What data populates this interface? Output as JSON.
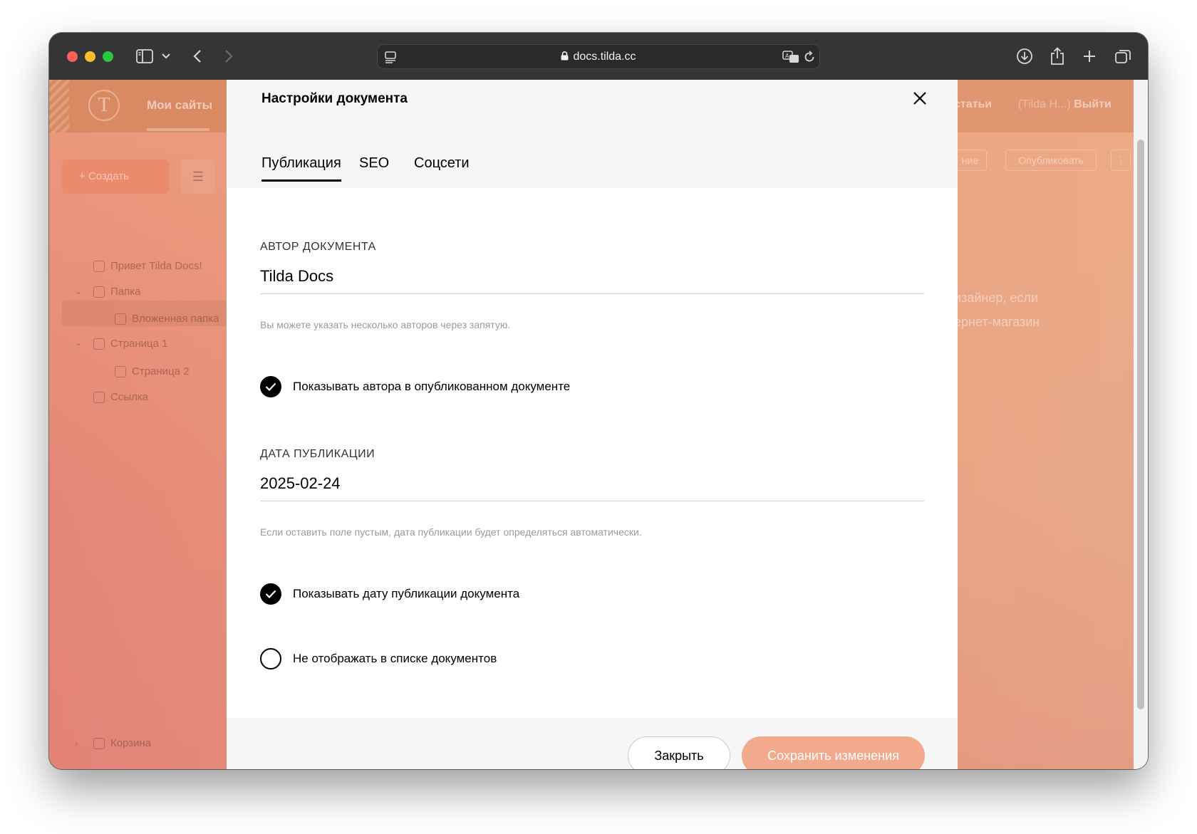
{
  "browser": {
    "url": "docs.tilda.cc"
  },
  "background": {
    "my_sites": "Мои сайты",
    "create": "+ Создать",
    "nav": [
      "Привет Tilda Docs!",
      "Папка",
      "Вложенная папка",
      "Страница 1",
      "Страница 2",
      "Ссылка"
    ],
    "trash": "Корзина",
    "top_articles": "статьи",
    "top_user": "(Tilda H...)",
    "top_logout": "Выйти",
    "pill_left": "ние",
    "pill_publish": "Опубликовать",
    "text_line_1": "изайнер, если",
    "text_line_2": "ернет-магазин"
  },
  "modal": {
    "title": "Настройки документа",
    "tabs": [
      {
        "label": "Публикация",
        "active": true
      },
      {
        "label": "SEO",
        "active": false
      },
      {
        "label": "Соцсети",
        "active": false
      }
    ],
    "author": {
      "label": "АВТОР ДОКУМЕНТА",
      "value": "Tilda Docs",
      "hint": "Вы можете указать несколько авторов через запятую."
    },
    "show_author": {
      "label": "Показывать автора в опубликованном документе",
      "checked": true
    },
    "date": {
      "label": "ДАТА ПУБЛИКАЦИИ",
      "value": "2025-02-24",
      "hint": "Если оставить поле пустым, дата публикации будет определяться автоматически."
    },
    "show_date": {
      "label": "Показывать дату публикации документа",
      "checked": true
    },
    "hide_in_list": {
      "label": "Не отображать в списке документов",
      "checked": false
    },
    "close_button": "Закрыть",
    "save_button": "Сохранить изменения"
  },
  "colors": {
    "accent": "#f2a98c",
    "background_gradient_start": "#e58777",
    "background_gradient_end": "#e8a98a"
  }
}
